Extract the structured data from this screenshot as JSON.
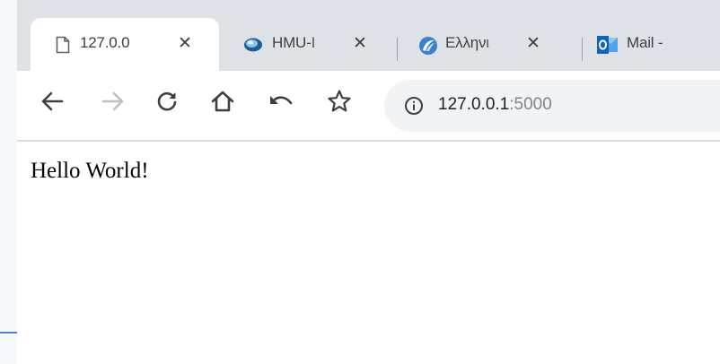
{
  "tabs": [
    {
      "title": "127.0.0",
      "icon": "document-icon",
      "active": true
    },
    {
      "title": "HMU-I",
      "icon": "hmu-logo-icon",
      "active": false
    },
    {
      "title": "Ελληνι",
      "icon": "greek-site-logo-icon",
      "active": false
    },
    {
      "title": "Mail - ",
      "icon": "outlook-icon",
      "active": false
    }
  ],
  "tab_close_symbol": "✕",
  "toolbar": {
    "buttons": [
      "back-icon",
      "forward-icon",
      "reload-icon",
      "home-icon",
      "undo-icon",
      "bookmark-star-icon"
    ]
  },
  "omnibox": {
    "host": "127.0.0.1",
    "port": ":5000",
    "info_icon": "info-icon"
  },
  "content": {
    "text": "Hello World!"
  },
  "colors": {
    "tabstrip": "#dee1e6",
    "omnibox": "#f1f3f4",
    "outlook_blue": "#0f62c3",
    "accent_line": "#4f86c6"
  }
}
